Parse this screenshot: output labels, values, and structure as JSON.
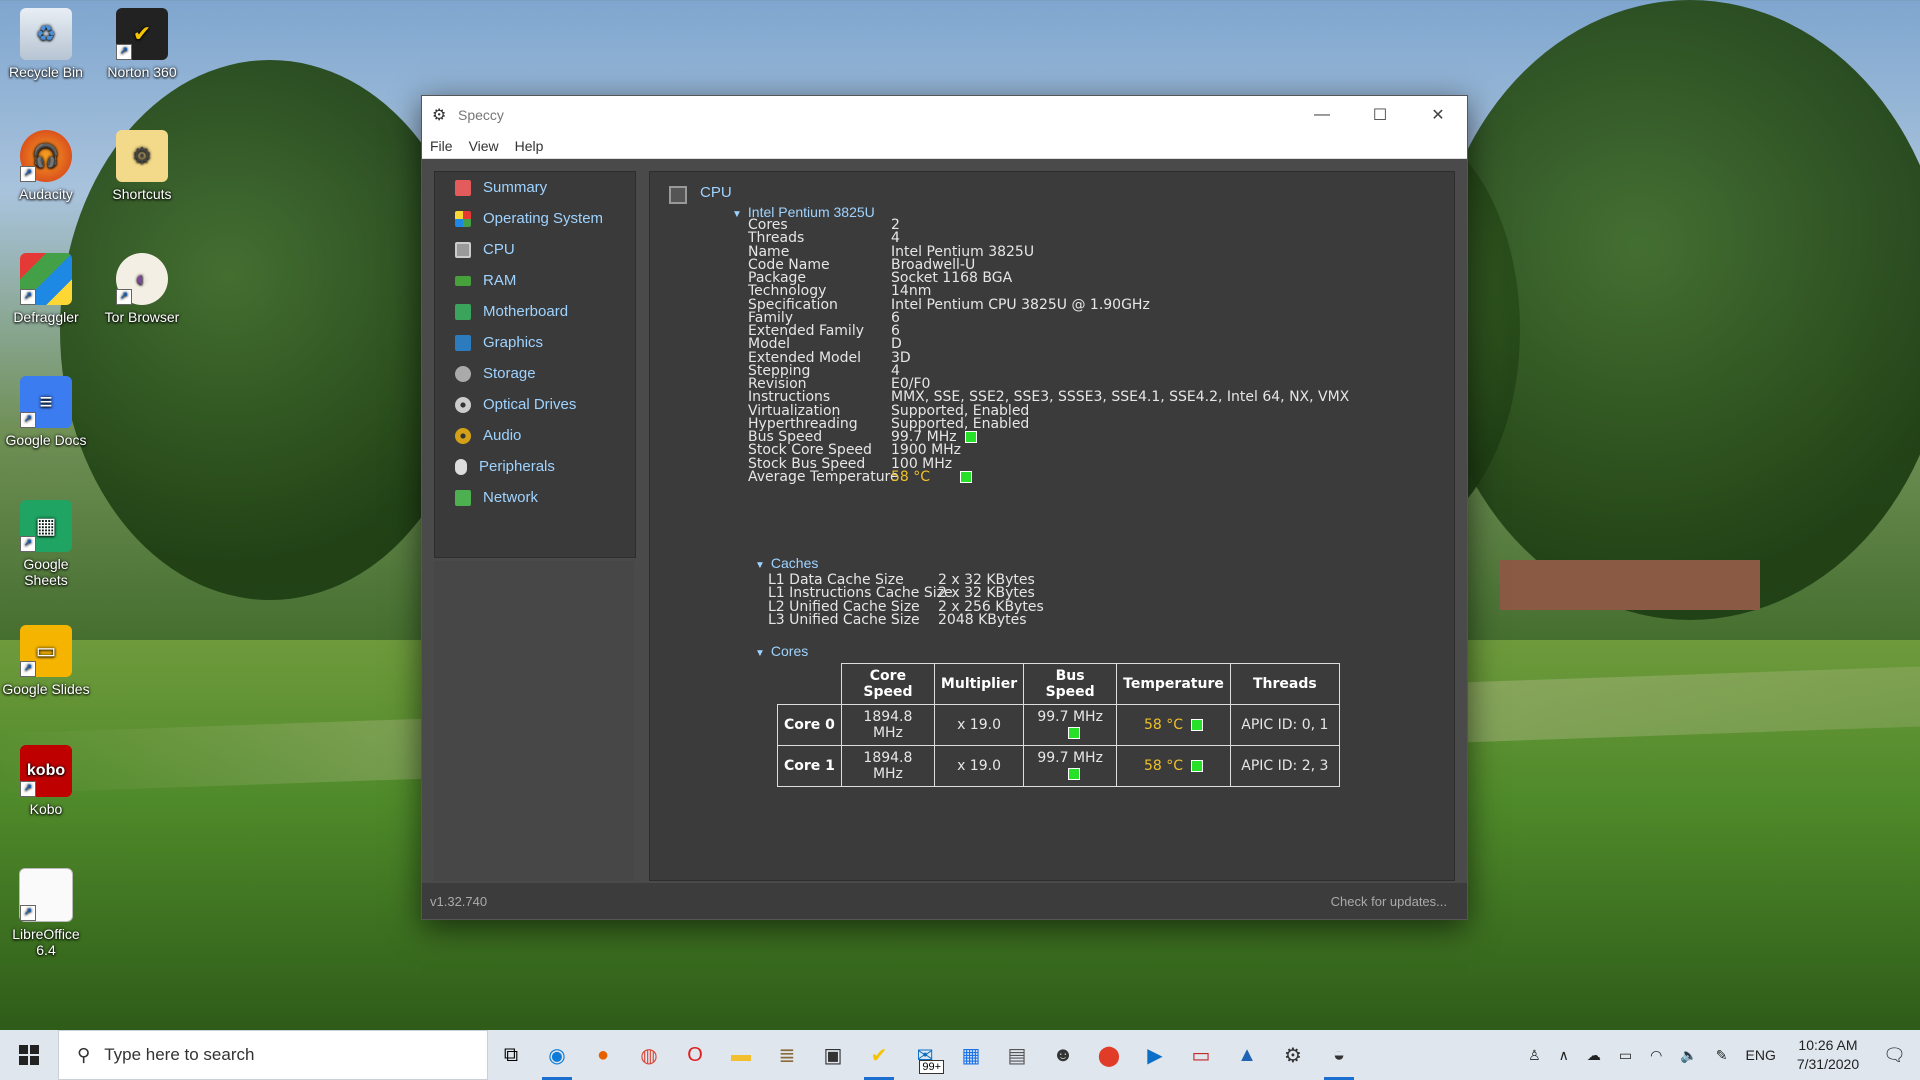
{
  "desktop": {
    "icons": [
      {
        "label": "Recycle Bin"
      },
      {
        "label": "Norton 360"
      },
      {
        "label": "Audacity"
      },
      {
        "label": "Shortcuts"
      },
      {
        "label": "Defraggler"
      },
      {
        "label": "Tor Browser"
      },
      {
        "label": "Google Docs"
      },
      {
        "label": "Google Sheets"
      },
      {
        "label": "Google Slides"
      },
      {
        "label": "Kobo"
      },
      {
        "label": "LibreOffice 6.4"
      }
    ]
  },
  "window": {
    "title": "Speccy",
    "menu": [
      "File",
      "View",
      "Help"
    ],
    "sidebar": [
      {
        "label": "Summary",
        "color": "#e45b5b"
      },
      {
        "label": "Operating System",
        "color": "#3a8ee6"
      },
      {
        "label": "CPU",
        "color": "#9a9a9a"
      },
      {
        "label": "RAM",
        "color": "#47a13b"
      },
      {
        "label": "Motherboard",
        "color": "#3aa35c"
      },
      {
        "label": "Graphics",
        "color": "#2d7bbf"
      },
      {
        "label": "Storage",
        "color": "#aaaaaa"
      },
      {
        "label": "Optical Drives",
        "color": "#888888"
      },
      {
        "label": "Audio",
        "color": "#d4a017"
      },
      {
        "label": "Peripherals",
        "color": "#dddddd"
      },
      {
        "label": "Network",
        "color": "#4caf50"
      }
    ],
    "section_title": "CPU",
    "processor": "Intel Pentium 3825U",
    "properties": [
      {
        "name": "Cores",
        "value": "2"
      },
      {
        "name": "Threads",
        "value": "4"
      },
      {
        "name": "Name",
        "value": "Intel Pentium 3825U"
      },
      {
        "name": "Code Name",
        "value": "Broadwell-U"
      },
      {
        "name": "Package",
        "value": "Socket 1168 BGA"
      },
      {
        "name": "Technology",
        "value": "14nm"
      },
      {
        "name": "Specification",
        "value": "Intel Pentium CPU 3825U @ 1.90GHz"
      },
      {
        "name": "Family",
        "value": "6"
      },
      {
        "name": "Extended Family",
        "value": "6"
      },
      {
        "name": "Model",
        "value": "D"
      },
      {
        "name": "Extended Model",
        "value": "3D"
      },
      {
        "name": "Stepping",
        "value": "4"
      },
      {
        "name": "Revision",
        "value": "E0/F0"
      },
      {
        "name": "Instructions",
        "value": "MMX, SSE, SSE2, SSE3, SSSE3, SSE4.1, SSE4.2, Intel 64, NX, VMX"
      },
      {
        "name": "Virtualization",
        "value": "Supported, Enabled"
      },
      {
        "name": "Hyperthreading",
        "value": "Supported, Enabled"
      },
      {
        "name": "Bus Speed",
        "value": "99.7 MHz"
      },
      {
        "name": "Stock Core Speed",
        "value": "1900 MHz"
      },
      {
        "name": "Stock Bus Speed",
        "value": "100 MHz"
      },
      {
        "name": "Average Temperature",
        "value": "58 °C"
      }
    ],
    "caches_label": "Caches",
    "caches": [
      {
        "name": "L1 Data Cache Size",
        "value": "2 x 32 KBytes"
      },
      {
        "name": "L1 Instructions Cache Size",
        "value": "2 x 32 KBytes"
      },
      {
        "name": "L2 Unified Cache Size",
        "value": "2 x 256 KBytes"
      },
      {
        "name": "L3 Unified Cache Size",
        "value": "2048 KBytes"
      }
    ],
    "cores_label": "Cores",
    "cores_table": {
      "headers": [
        "Core Speed",
        "Multiplier",
        "Bus Speed",
        "Temperature",
        "Threads"
      ],
      "rows": [
        {
          "core": "Core 0",
          "speed": "1894.8 MHz",
          "multiplier": "x 19.0",
          "bus": "99.7 MHz",
          "temp": "58 °C",
          "threads": "APIC ID: 0, 1"
        },
        {
          "core": "Core 1",
          "speed": "1894.8 MHz",
          "multiplier": "x 19.0",
          "bus": "99.7 MHz",
          "temp": "58 °C",
          "threads": "APIC ID: 2, 3"
        }
      ]
    },
    "version": "v1.32.740",
    "check_updates": "Check for updates..."
  },
  "taskbar": {
    "search_placeholder": "Type here to search",
    "badge": "99+",
    "language": "ENG",
    "time": "10:26 AM",
    "date": "7/31/2020"
  }
}
